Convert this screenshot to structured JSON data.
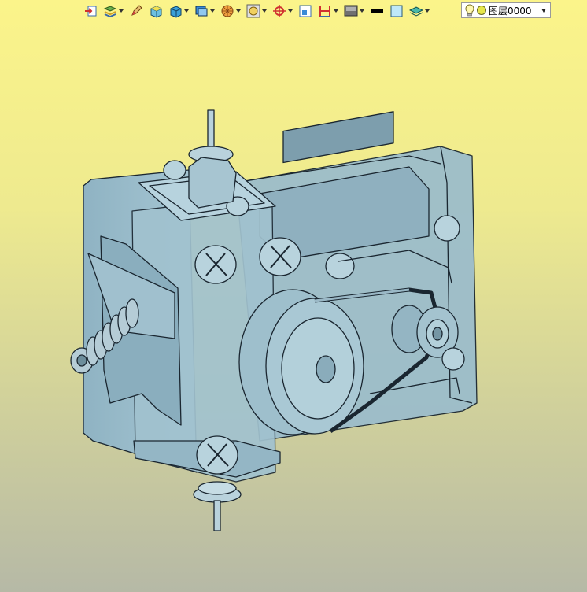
{
  "toolbar": {
    "buttons": [
      {
        "name": "exit-sketch-icon",
        "caret": false
      },
      {
        "name": "layers-icon",
        "caret": true
      },
      {
        "name": "pencil-icon",
        "caret": false
      },
      {
        "name": "shaded-box-icon",
        "caret": false
      },
      {
        "name": "solid-box-icon",
        "caret": true
      },
      {
        "name": "view-cube-icon",
        "caret": true
      },
      {
        "name": "render-sphere-icon",
        "caret": true
      },
      {
        "name": "zoom-fit-icon",
        "caret": true
      },
      {
        "name": "orient-icon",
        "caret": true
      },
      {
        "name": "frame-select-icon",
        "caret": false
      },
      {
        "name": "dimension-icon",
        "caret": true
      },
      {
        "name": "display-mode-icon",
        "caret": true
      },
      {
        "name": "line-style-icon",
        "caret": false
      },
      {
        "name": "fill-color-icon",
        "caret": false
      },
      {
        "name": "layer-stack-icon",
        "caret": true
      }
    ],
    "layer": {
      "value": "图层0000",
      "lamp_icon": "lightbulb-icon",
      "color": "#e6e64a"
    }
  },
  "viewport": {
    "background_top": "#fbf48a",
    "background_bottom": "#b6b9a6",
    "model_color": "#9bbccb",
    "edge_color": "#1a2630"
  }
}
